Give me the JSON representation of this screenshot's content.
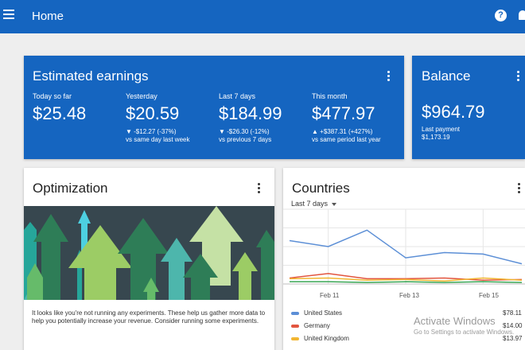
{
  "header": {
    "title": "Home"
  },
  "earnings": {
    "title": "Estimated earnings",
    "metrics": [
      {
        "label": "Today so far",
        "value": "$25.48",
        "change": "",
        "comparison": ""
      },
      {
        "label": "Yesterday",
        "value": "$20.59",
        "change": "▼ -$12.27 (-37%)",
        "comparison": "vs same day last week"
      },
      {
        "label": "Last 7 days",
        "value": "$184.99",
        "change": "▼ -$26.30 (-12%)",
        "comparison": "vs previous 7 days"
      },
      {
        "label": "This month",
        "value": "$477.97",
        "change": "▲ +$387.31 (+427%)",
        "comparison": "vs same period last year"
      }
    ]
  },
  "balance": {
    "title": "Balance",
    "value": "$964.79",
    "last_payment_label": "Last payment",
    "last_payment_value": "$1,173.19"
  },
  "optimization": {
    "title": "Optimization",
    "description": "It looks like you're not running any experiments. These help us gather more data to help you potentially increase your revenue. Consider running some experiments."
  },
  "countries": {
    "title": "Countries",
    "range_label": "Last 7 days",
    "ticks": [
      "Feb 11",
      "Feb 13",
      "Feb 15"
    ],
    "legend": [
      {
        "name": "United States",
        "amount": "$78.11",
        "color": "#5c8fd6"
      },
      {
        "name": "Germany",
        "amount": "$14.00",
        "color": "#e2553f"
      },
      {
        "name": "United Kingdom",
        "amount": "$13.97",
        "color": "#f2b632"
      }
    ]
  },
  "chart_data": {
    "type": "line",
    "x": [
      "Feb 10",
      "Feb 11",
      "Feb 12",
      "Feb 13",
      "Feb 14",
      "Feb 15",
      "Feb 16"
    ],
    "xlabel": "",
    "ylabel": "",
    "ylim": [
      0,
      100
    ],
    "grid": true,
    "legend_placement": "bottom",
    "series": [
      {
        "name": "United States",
        "values": [
          58,
          50,
          72,
          35,
          42,
          40,
          27
        ],
        "color": "#5c8fd6"
      },
      {
        "name": "Germany",
        "values": [
          8,
          14,
          7,
          7,
          8,
          5,
          6
        ],
        "color": "#e2553f"
      },
      {
        "name": "United Kingdom",
        "values": [
          7,
          8,
          5,
          6,
          4,
          8,
          5
        ],
        "color": "#f2b632"
      },
      {
        "name": "",
        "values": [
          3,
          3,
          2,
          3,
          2,
          3,
          2
        ],
        "color": "#3aa655"
      }
    ]
  },
  "watermark": {
    "line1": "Activate Windows",
    "line2": "Go to Settings to activate Windows."
  }
}
